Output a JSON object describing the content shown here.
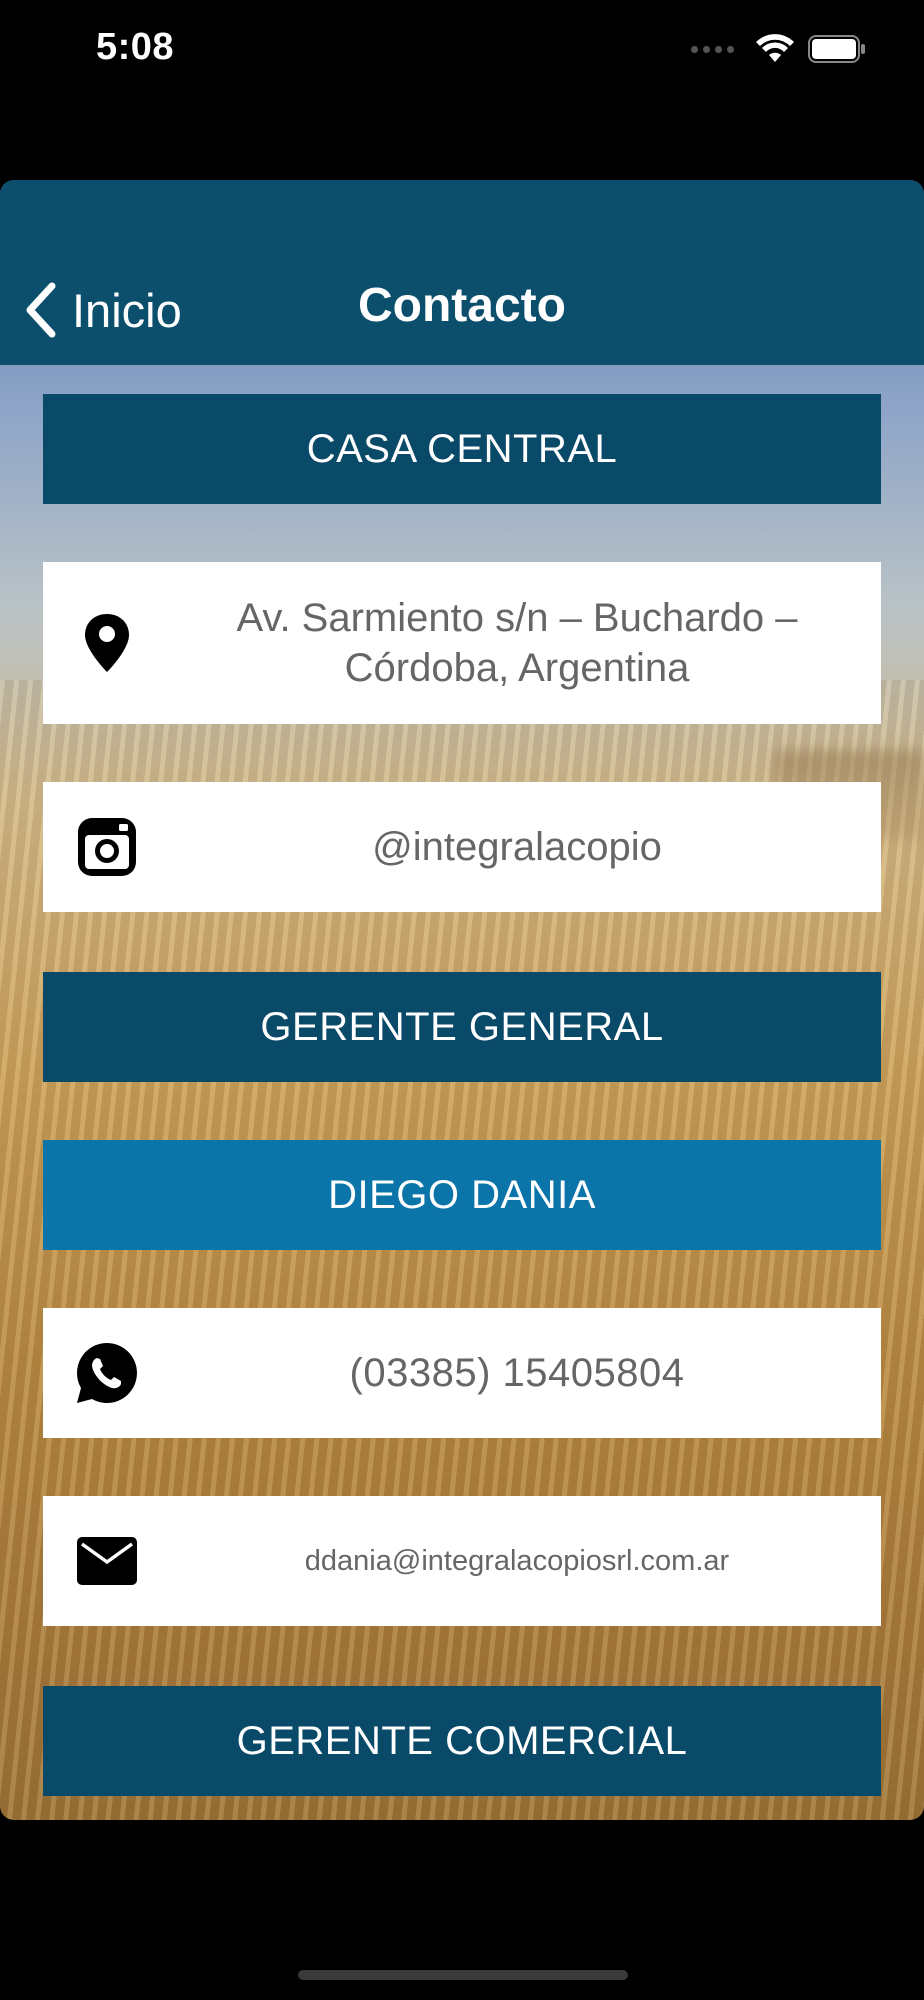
{
  "status_bar": {
    "time": "5:08"
  },
  "nav": {
    "back_label": "Inicio",
    "title": "Contacto"
  },
  "sections": {
    "casa_central": "CASA CENTRAL",
    "address": "Av. Sarmiento s/n – Buchardo – Córdoba, Argentina",
    "instagram": "@integralacopio",
    "gerente_general": "GERENTE GENERAL",
    "gerente_general_name": "DIEGO DANIA",
    "phone": "(03385) 15405804",
    "email": "ddania@integralacopiosrl.com.ar",
    "gerente_comercial": "GERENTE COMERCIAL"
  },
  "colors": {
    "nav_background": "#0b4f6d",
    "header_row": "#0a4a69",
    "name_row": "#0b74a8",
    "info_row": "#ffffff"
  }
}
